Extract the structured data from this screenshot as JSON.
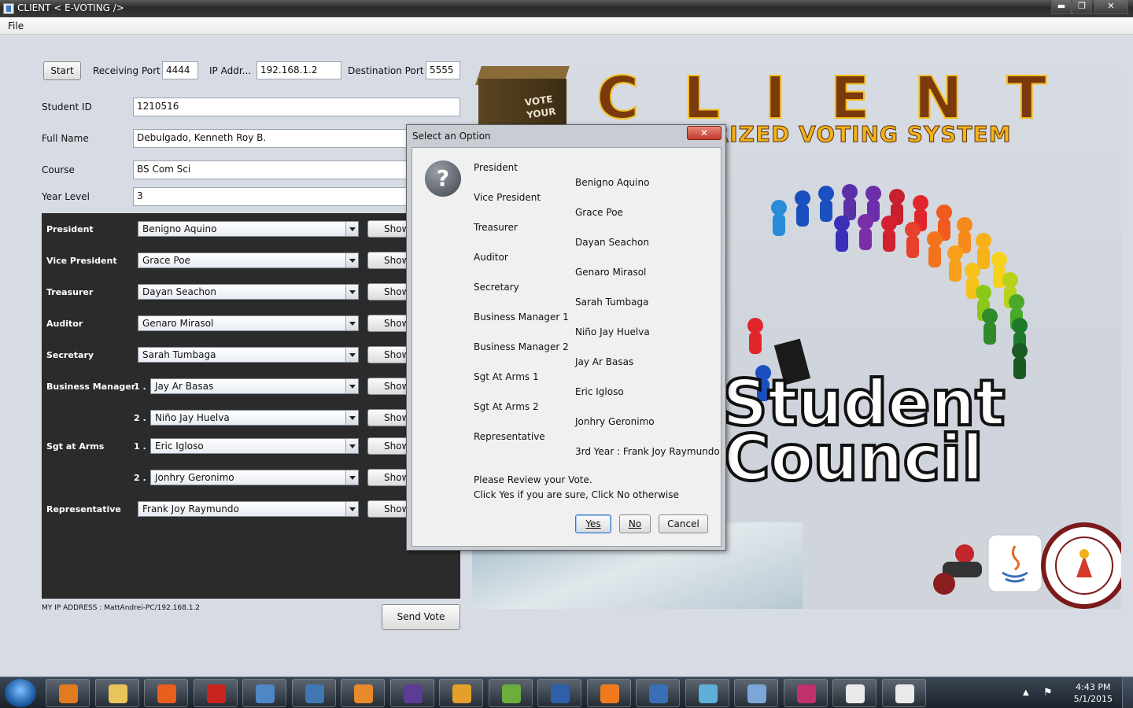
{
  "window": {
    "title": "CLIENT   < E-VOTING />",
    "minimize": "▬",
    "maximize": "❐",
    "close": "✕"
  },
  "menubar": {
    "file": "File"
  },
  "connection": {
    "start_label": "Start",
    "receiving_port_label": "Receiving Port",
    "receiving_port_value": "4444",
    "ip_label": "IP Addr...",
    "ip_value": "192.168.1.2",
    "destination_port_label": "Destination Port",
    "destination_port_value": "5555"
  },
  "student": {
    "id_label": "Student ID",
    "id_value": "1210516",
    "name_label": "Full Name",
    "name_value": "Debulgado, Kenneth Roy B.",
    "course_label": "Course",
    "course_value": "BS Com Sci",
    "year_label": "Year Level",
    "year_value": "3"
  },
  "ballot": {
    "show_label": "Show",
    "positions": [
      {
        "label": "President",
        "num": "",
        "selected": "Benigno Aquino"
      },
      {
        "label": "Vice President",
        "num": "",
        "selected": "Grace Poe"
      },
      {
        "label": "Treasurer",
        "num": "",
        "selected": "Dayan Seachon"
      },
      {
        "label": "Auditor",
        "num": "",
        "selected": "Genaro Mirasol"
      },
      {
        "label": "Secretary",
        "num": "",
        "selected": "Sarah Tumbaga"
      },
      {
        "label": "Business Manager",
        "num": "1 .",
        "selected": "Jay Ar Basas"
      },
      {
        "label": "",
        "num": "2 .",
        "selected": "Niño Jay Huelva"
      },
      {
        "label": "Sgt at Arms",
        "num": "1 .",
        "selected": "Eric Igloso"
      },
      {
        "label": "",
        "num": "2 .",
        "selected": "Jonhry Geronimo"
      },
      {
        "label": "Representative",
        "num": "",
        "selected": "Frank Joy Raymundo"
      }
    ]
  },
  "footer": {
    "ip_info": "MY IP ADDRESS :  MattAndrei-PC/192.168.1.2",
    "send_label": "Send Vote"
  },
  "art": {
    "ballot_box_text_1": "VOTE",
    "ballot_box_text_2": "YOUR",
    "title": "CLIENT",
    "subtitle": "COMPUTERIZED VOTING SYSTEM",
    "word1": "Student",
    "word2": "Council"
  },
  "dialog": {
    "title": "Select an Option",
    "close": "✕",
    "question_mark": "?",
    "positions": [
      "President",
      "Vice President",
      "Treasurer",
      "Auditor",
      "Secretary",
      "Business Manager 1",
      "Business Manager 2",
      "Sgt At Arms 1",
      "Sgt At Arms 2",
      "Representative"
    ],
    "candidates": [
      "Benigno Aquino",
      "Grace Poe",
      "Dayan Seachon",
      "Genaro Mirasol",
      "Sarah Tumbaga",
      "Niño Jay Huelva",
      "Jay Ar Basas",
      "Eric Igloso",
      "Jonhry Geronimo",
      "3rd Year : Frank Joy Raymundo"
    ],
    "review_line_1": "Please Review your Vote.",
    "review_line_2": "Click Yes if you are sure, Click No otherwise",
    "yes_label": "Yes",
    "no_label": "No",
    "cancel_label": "Cancel"
  },
  "taskbar": {
    "time": "4:43 PM",
    "date": "5/1/2015",
    "tray_arrow": "▲",
    "flag": "⚑",
    "items": [
      {
        "name": "media-player-icon",
        "color": "#e07b1f"
      },
      {
        "name": "file-explorer-icon",
        "color": "#e9c45a"
      },
      {
        "name": "firefox-icon",
        "color": "#e8601c"
      },
      {
        "name": "pdf-reader-icon",
        "color": "#c9251e"
      },
      {
        "name": "3d-box-icon",
        "color": "#4f86c6"
      },
      {
        "name": "python-icon",
        "color": "#3f78b3"
      },
      {
        "name": "matlab-icon",
        "color": "#e8892a"
      },
      {
        "name": "eclipse-icon",
        "color": "#5b3e93"
      },
      {
        "name": "arduino-icon",
        "color": "#e4a02a"
      },
      {
        "name": "notepad-plus-icon",
        "color": "#6cae3e"
      },
      {
        "name": "devcpp-icon",
        "color": "#2e5fa8"
      },
      {
        "name": "xampp-icon",
        "color": "#f07b1e"
      },
      {
        "name": "monitor-app-icon",
        "color": "#3a6fb5"
      },
      {
        "name": "notes-app-icon",
        "color": "#5fb0d8"
      },
      {
        "name": "paint-icon",
        "color": "#7ba7d8"
      },
      {
        "name": "pen-tool-icon",
        "color": "#c0306b"
      },
      {
        "name": "java-app-icon-1",
        "color": "#e9e9e9"
      },
      {
        "name": "java-app-icon-2",
        "color": "#e9e9e9"
      }
    ]
  }
}
